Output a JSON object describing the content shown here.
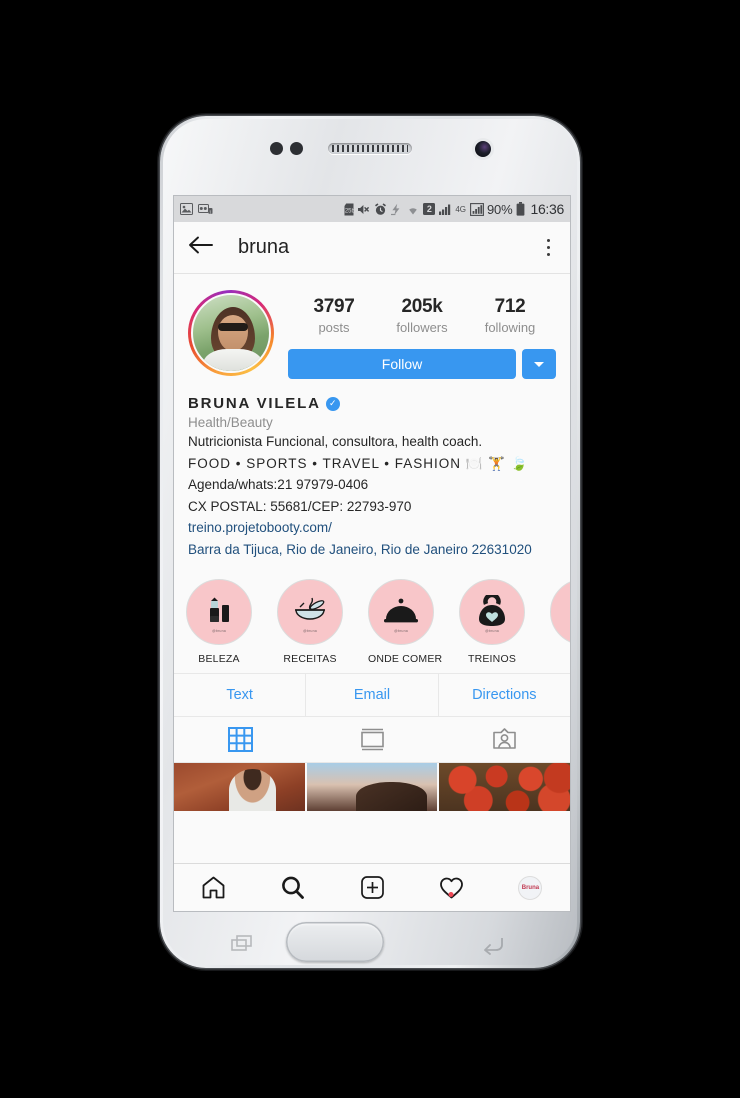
{
  "status_bar": {
    "left_icons": [
      "photo-notification-icon",
      "screen-record-notification-icon"
    ],
    "right_icons": [
      "sd-card-icon",
      "mute-icon",
      "alarm-icon",
      "power-saving-icon",
      "wifi-icon"
    ],
    "sim_badge": "2",
    "network_label": "4G",
    "battery_percent": "90%",
    "clock": "16:36"
  },
  "app_bar": {
    "back_label": "back-arrow",
    "title": "bruna",
    "overflow_label": "more-options"
  },
  "profile": {
    "avatar_alt": "bruna-profile-photo",
    "stats": [
      {
        "value": "3797",
        "label": "posts"
      },
      {
        "value": "205k",
        "label": "followers"
      },
      {
        "value": "712",
        "label": "following"
      }
    ],
    "follow_label": "Follow",
    "dropdown_label": "more-follow-options"
  },
  "bio": {
    "name": "BRUNA VILELA",
    "verified": "✓",
    "category": "Health/Beauty",
    "lines": [
      {
        "text": "Nutricionista Funcional, consultora, health coach.",
        "link": false
      },
      {
        "text": "FOOD • SPORTS • TRAVEL • FASHION 🍽️ 🏋️ 🍃",
        "link": false
      },
      {
        "text": "Agenda/whats:21 97979-0406",
        "link": false
      },
      {
        "text": "CX POSTAL: 55681/CEP: 22793-970",
        "link": false
      },
      {
        "text": "treino.projetobooty.com/",
        "link": true
      },
      {
        "text": "Barra da Tijuca, Rio de Janeiro, Rio de Janeiro 22631020",
        "link": true
      }
    ]
  },
  "highlights": {
    "circle_color": "#f8c6c9",
    "watermark": "@bruna",
    "items": [
      {
        "label": "BELEZA",
        "icon": "lipstick-icon"
      },
      {
        "label": "RECEITAS",
        "icon": "bowl-icon"
      },
      {
        "label": "ONDE COMER",
        "icon": "food-cloche-icon"
      },
      {
        "label": "TREINOS",
        "icon": "kettlebell-icon"
      },
      {
        "label": "",
        "icon": "partial-highlight-icon"
      }
    ]
  },
  "contact_actions": [
    {
      "label": "Text",
      "name": "text-button"
    },
    {
      "label": "Email",
      "name": "email-button"
    },
    {
      "label": "Directions",
      "name": "directions-button"
    }
  ],
  "tabs": [
    {
      "name": "tab-grid",
      "icon": "grid-icon",
      "active": true
    },
    {
      "name": "tab-feed",
      "icon": "list-feed-icon",
      "active": false
    },
    {
      "name": "tab-tagged",
      "icon": "tagged-person-icon",
      "active": false
    }
  ],
  "grid": [
    {
      "name": "grid-cell-woman-wall",
      "alt": "woman-in-denim-against-red-wall"
    },
    {
      "name": "grid-cell-portrait-sky",
      "alt": "portrait-against-sky"
    },
    {
      "name": "grid-cell-tomatoes",
      "alt": "roasted-tomatoes"
    }
  ],
  "bottom_nav": [
    {
      "name": "nav-home",
      "icon": "home-icon",
      "badge": false
    },
    {
      "name": "nav-search",
      "icon": "search-icon",
      "badge": false
    },
    {
      "name": "nav-add",
      "icon": "plus-square-icon",
      "badge": false
    },
    {
      "name": "nav-activity",
      "icon": "heart-icon",
      "badge": true
    },
    {
      "name": "nav-profile",
      "icon": "profile-avatar-icon",
      "badge": false,
      "avatar_text": "Bruna"
    }
  ],
  "device": {
    "hardware_keys": [
      "recents-key",
      "home-button",
      "back-key"
    ],
    "accent_blue": "#3897f0",
    "accent_pink": "#f8c6c9"
  }
}
